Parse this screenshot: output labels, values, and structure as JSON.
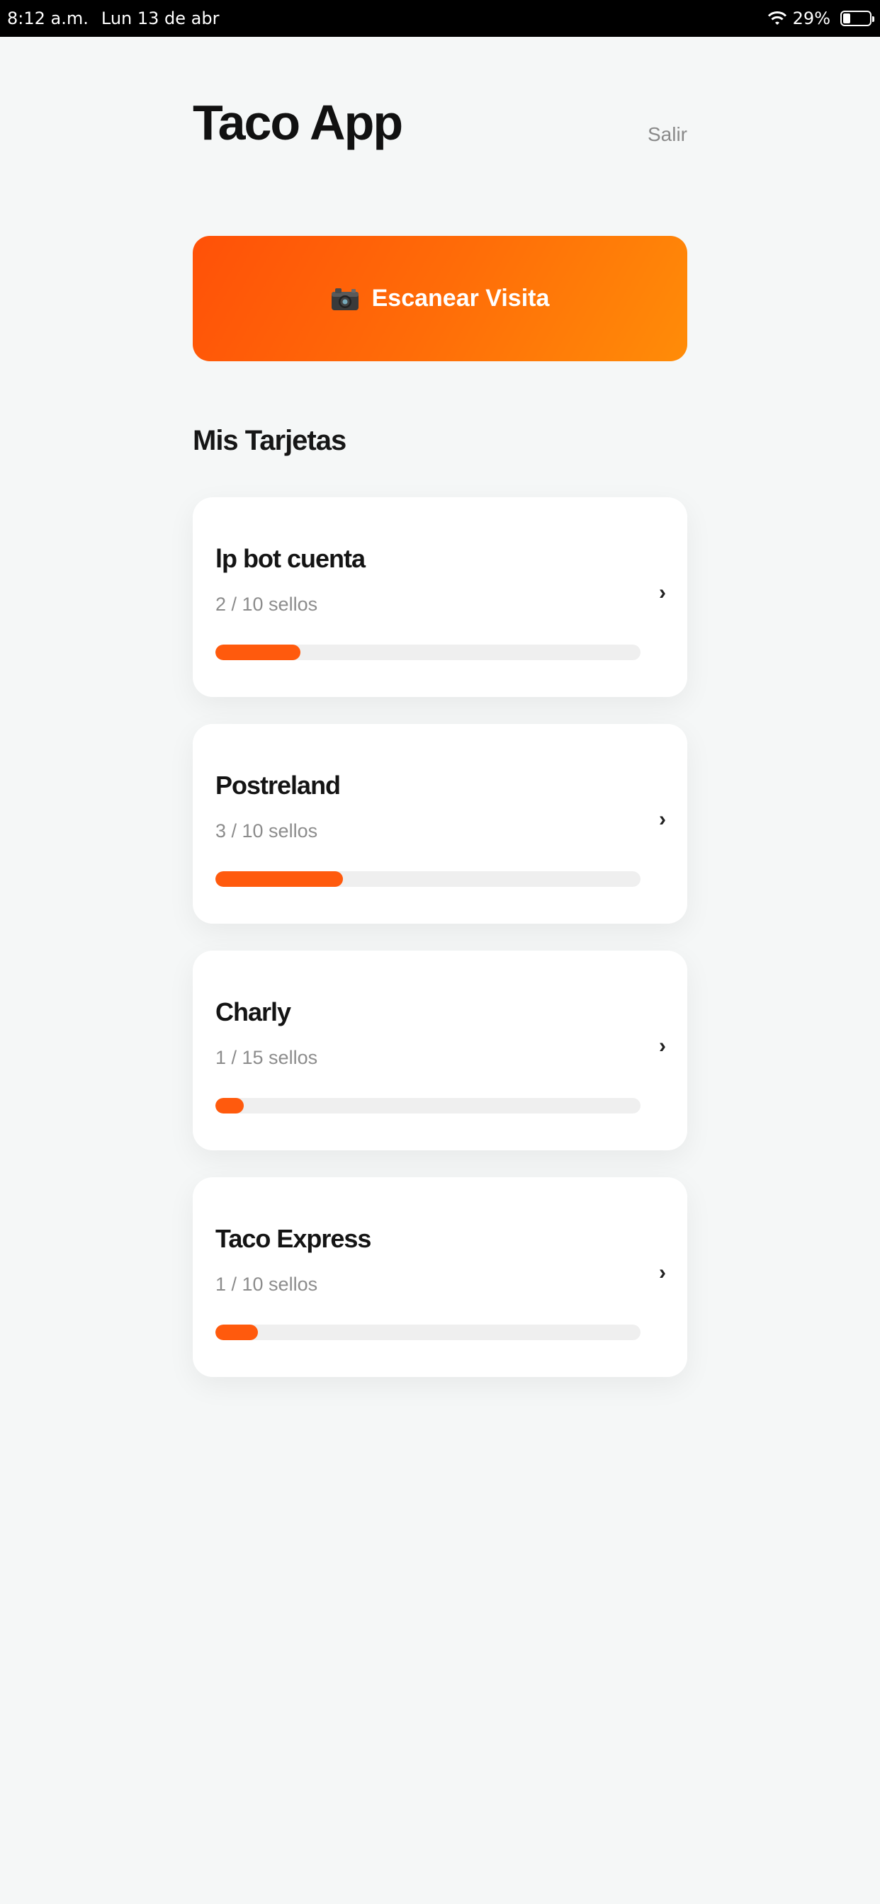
{
  "status_bar": {
    "time": "8:12 a.m.",
    "date": "Lun 13 de abr",
    "battery": "29%",
    "battery_level": 0.29
  },
  "header": {
    "title": "Taco App",
    "logout_label": "Salir"
  },
  "scan_button": {
    "icon": "camera-icon",
    "label": "Escanear Visita"
  },
  "section": {
    "title": "Mis Tarjetas"
  },
  "colors": {
    "accent": "#ff5a0d",
    "gradient_start": "#ff5108",
    "gradient_end": "#ff8c08",
    "track": "#efefef"
  },
  "cards": [
    {
      "name": "lp bot cuenta",
      "stamps": "2 / 10 sellos",
      "progress": 0.2
    },
    {
      "name": "Postreland",
      "stamps": "3 / 10 sellos",
      "progress": 0.3
    },
    {
      "name": "Charly",
      "stamps": "1 / 15 sellos",
      "progress": 0.0667
    },
    {
      "name": "Taco Express",
      "stamps": "1 / 10 sellos",
      "progress": 0.1
    }
  ],
  "chevron": "›"
}
